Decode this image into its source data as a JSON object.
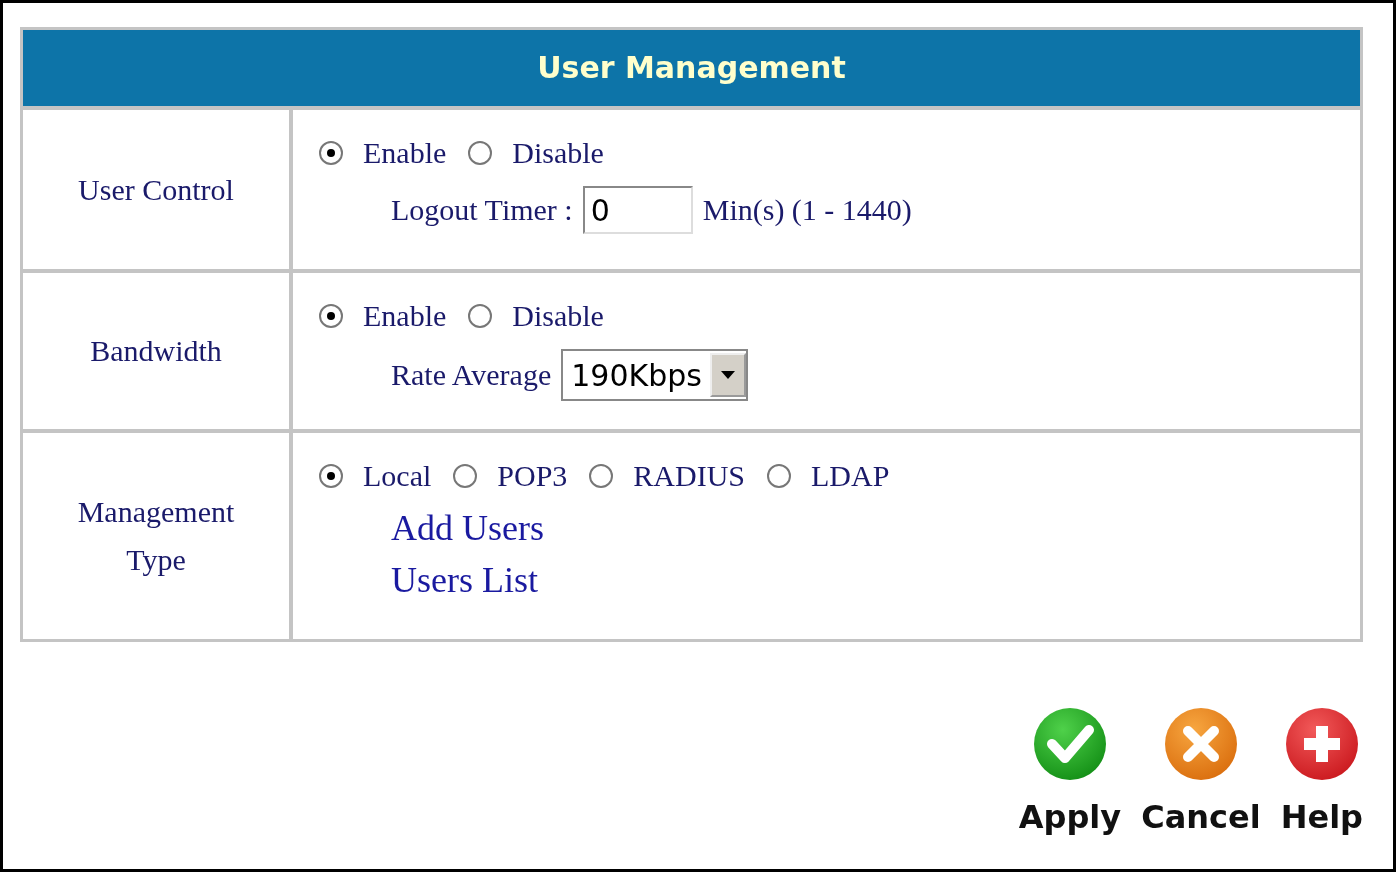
{
  "title": "User Management",
  "rows": [
    {
      "label": "User Control",
      "radios": [
        {
          "label": "Enable",
          "selected": true
        },
        {
          "label": "Disable",
          "selected": false
        }
      ],
      "field": {
        "kind": "text",
        "label": "Logout Timer :",
        "value": "0",
        "suffix": "Min(s) (1 - 1440)"
      }
    },
    {
      "label": "Bandwidth",
      "radios": [
        {
          "label": "Enable",
          "selected": true
        },
        {
          "label": "Disable",
          "selected": false
        }
      ],
      "field": {
        "kind": "select",
        "label": "Rate Average",
        "value": "190Kbps"
      }
    },
    {
      "label": "Management Type",
      "radios": [
        {
          "label": "Local",
          "selected": true
        },
        {
          "label": "POP3",
          "selected": false
        },
        {
          "label": "RADIUS",
          "selected": false
        },
        {
          "label": "LDAP",
          "selected": false
        }
      ],
      "links": [
        "Add Users",
        "Users List"
      ]
    }
  ],
  "buttons": [
    {
      "label": "Apply",
      "kind": "apply"
    },
    {
      "label": "Cancel",
      "kind": "cancel"
    },
    {
      "label": "Help",
      "kind": "help"
    }
  ]
}
